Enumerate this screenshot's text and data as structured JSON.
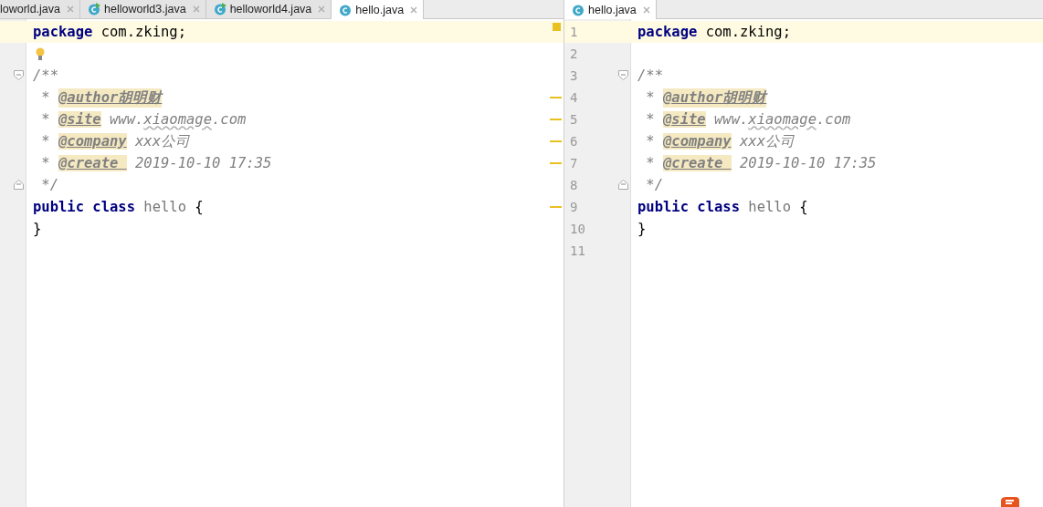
{
  "panes": [
    {
      "line_numbers": false,
      "tabs": [
        {
          "label": "loworld.java",
          "kind": "plain",
          "selected": false
        },
        {
          "label": "helloworld3.java",
          "kind": "runnable_class",
          "selected": false
        },
        {
          "label": "helloworld4.java",
          "kind": "runnable_class",
          "selected": false
        },
        {
          "label": "hello.java",
          "kind": "class",
          "selected": true
        }
      ],
      "lines": [
        {
          "kind": "code",
          "current": true,
          "tokens": [
            {
              "kind": "keyword",
              "text": "package"
            },
            {
              "kind": "text",
              "text": " com.zking;"
            }
          ]
        },
        {
          "kind": "code",
          "hint": true
        },
        {
          "kind": "fold_start",
          "tokens": [
            {
              "kind": "comment",
              "text": "/**"
            }
          ]
        },
        {
          "kind": "code",
          "marker": true,
          "tokens": [
            {
              "kind": "comment",
              "text": " * "
            },
            {
              "kind": "tag",
              "text": "@author胡明财"
            }
          ]
        },
        {
          "kind": "code",
          "marker": true,
          "tokens": [
            {
              "kind": "comment",
              "text": " * "
            },
            {
              "kind": "tag",
              "text": "@site"
            },
            {
              "kind": "comment",
              "text": " www."
            },
            {
              "kind": "typo",
              "text": "xiaomage"
            },
            {
              "kind": "comment",
              "text": ".com"
            }
          ]
        },
        {
          "kind": "code",
          "marker": true,
          "tokens": [
            {
              "kind": "comment",
              "text": " * "
            },
            {
              "kind": "tag",
              "text": "@company"
            },
            {
              "kind": "comment",
              "text": " xxx公司"
            }
          ]
        },
        {
          "kind": "code",
          "marker": true,
          "tokens": [
            {
              "kind": "comment",
              "text": " * "
            },
            {
              "kind": "tag",
              "text": "@create "
            },
            {
              "kind": "comment",
              "text": " 2019-10-10 17:35"
            }
          ]
        },
        {
          "kind": "fold_end",
          "tokens": [
            {
              "kind": "comment",
              "text": " */"
            }
          ]
        },
        {
          "kind": "code",
          "marker": true,
          "tokens": [
            {
              "kind": "keyword",
              "text": "public class"
            },
            {
              "kind": "ident",
              "text": " hello"
            },
            {
              "kind": "text",
              "text": " {"
            }
          ]
        },
        {
          "kind": "code",
          "tokens": [
            {
              "kind": "text",
              "text": "}"
            }
          ]
        }
      ]
    },
    {
      "line_numbers": true,
      "tabs": [
        {
          "label": "hello.java",
          "kind": "class",
          "selected": true
        }
      ],
      "lines": [
        {
          "kind": "code",
          "number": "1",
          "current": true,
          "tokens": [
            {
              "kind": "keyword",
              "text": "package"
            },
            {
              "kind": "text",
              "text": " com.zking;"
            }
          ]
        },
        {
          "kind": "code",
          "number": "2"
        },
        {
          "kind": "fold_start",
          "number": "3",
          "tokens": [
            {
              "kind": "comment",
              "text": "/**"
            }
          ]
        },
        {
          "kind": "code",
          "number": "4",
          "tokens": [
            {
              "kind": "comment",
              "text": " * "
            },
            {
              "kind": "tag",
              "text": "@author胡明财"
            }
          ]
        },
        {
          "kind": "code",
          "number": "5",
          "tokens": [
            {
              "kind": "comment",
              "text": " * "
            },
            {
              "kind": "tag",
              "text": "@site"
            },
            {
              "kind": "comment",
              "text": " www."
            },
            {
              "kind": "typo",
              "text": "xiaomage"
            },
            {
              "kind": "comment",
              "text": ".com"
            }
          ]
        },
        {
          "kind": "code",
          "number": "6",
          "tokens": [
            {
              "kind": "comment",
              "text": " * "
            },
            {
              "kind": "tag",
              "text": "@company"
            },
            {
              "kind": "comment",
              "text": " xxx公司"
            }
          ]
        },
        {
          "kind": "code",
          "number": "7",
          "tokens": [
            {
              "kind": "comment",
              "text": " * "
            },
            {
              "kind": "tag",
              "text": "@create "
            },
            {
              "kind": "comment",
              "text": " 2019-10-10 17:35"
            }
          ]
        },
        {
          "kind": "fold_end",
          "number": "8",
          "tokens": [
            {
              "kind": "comment",
              "text": " */"
            }
          ]
        },
        {
          "kind": "code",
          "number": "9",
          "tokens": [
            {
              "kind": "keyword",
              "text": "public class"
            },
            {
              "kind": "ident",
              "text": " hello"
            },
            {
              "kind": "text",
              "text": " {"
            }
          ]
        },
        {
          "kind": "code",
          "number": "10",
          "tokens": [
            {
              "kind": "text",
              "text": "}"
            }
          ]
        },
        {
          "kind": "code",
          "number": "11"
        }
      ]
    }
  ]
}
